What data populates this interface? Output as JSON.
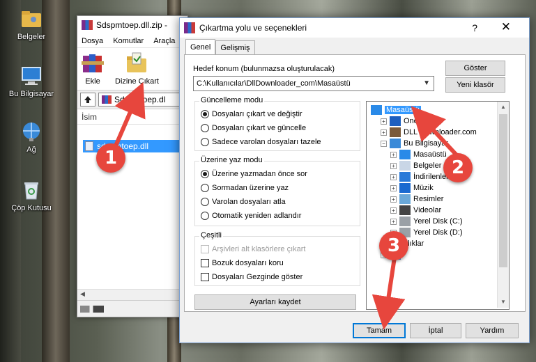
{
  "desktop": {
    "icons": [
      {
        "label": "Belgeler",
        "icon": "folder-user-icon"
      },
      {
        "label": "Bu Bilgisayar",
        "icon": "computer-icon"
      },
      {
        "label": "Ağ",
        "icon": "network-icon"
      },
      {
        "label": "Çöp Kutusu",
        "icon": "recycle-bin-icon"
      }
    ]
  },
  "bg_window": {
    "title": "Sdspmtoep.dll.zip - ",
    "menu": [
      "Dosya",
      "Komutlar",
      "Araçla"
    ],
    "toolbar": {
      "add_label": "Ekle",
      "extract_label": "Dizine Çıkart"
    },
    "address": "Sdspmtoep.dl",
    "column_header": "İsim",
    "file_name": "sdspmtoep.dll"
  },
  "dialog": {
    "title": "Çıkartma yolu ve seçenekleri",
    "help_glyph": "?",
    "close_glyph": "✕",
    "tabs": [
      "Genel",
      "Gelişmiş"
    ],
    "dest_label": "Hedef konum (bulunmazsa oluşturulacak)",
    "dest_path": "C:\\Kullanıcılar\\DllDownloader_com\\Masaüstü",
    "show_button": "Göster",
    "new_folder_button": "Yeni klasör",
    "update_mode": {
      "title": "Güncelleme modu",
      "options": [
        "Dosyaları çıkart ve değiştir",
        "Dosyaları çıkart ve güncelle",
        "Sadece varolan dosyaları tazele"
      ],
      "selected": 0
    },
    "overwrite_mode": {
      "title": "Üzerine yaz modu",
      "options": [
        "Üzerine yazmadan önce sor",
        "Sormadan üzerine yaz",
        "Varolan dosyaları atla",
        "Otomatik yeniden adlandır"
      ],
      "selected": 0
    },
    "misc": {
      "title": "Çeşitli",
      "options": [
        "Arşivleri alt klasörlere çıkart",
        "Bozuk dosyaları koru",
        "Dosyaları Gezginde göster"
      ],
      "disabled": [
        true,
        false,
        false
      ],
      "checked": [
        false,
        false,
        false
      ]
    },
    "save_settings_button": "Ayarları kaydet",
    "tree": [
      {
        "label": "Masaüstü",
        "icon": "desktop-icon",
        "level": 0,
        "selected": true,
        "expander": ""
      },
      {
        "label": "OneDrive",
        "icon": "cloud-icon",
        "level": 1,
        "expander": "+"
      },
      {
        "label": "DLL Downloader.com",
        "icon": "user-icon",
        "level": 1,
        "expander": "+"
      },
      {
        "label": "Bu Bilgisayar",
        "icon": "computer-icon",
        "level": 1,
        "expander": "−"
      },
      {
        "label": "Masaüstü",
        "icon": "desktop-icon",
        "level": 2,
        "expander": "+"
      },
      {
        "label": "Belgeler",
        "icon": "documents-icon",
        "level": 2,
        "expander": "+"
      },
      {
        "label": "İndirilenler",
        "icon": "downloads-icon",
        "level": 2,
        "expander": "+"
      },
      {
        "label": "Müzik",
        "icon": "music-icon",
        "level": 2,
        "expander": "+"
      },
      {
        "label": "Resimler",
        "icon": "pictures-icon",
        "level": 2,
        "expander": "+"
      },
      {
        "label": "Videolar",
        "icon": "videos-icon",
        "level": 2,
        "expander": "+"
      },
      {
        "label": "Yerel Disk (C:)",
        "icon": "drive-icon",
        "level": 2,
        "expander": "+"
      },
      {
        "label": "Yerel Disk (D:)",
        "icon": "drive-icon",
        "level": 2,
        "expander": "+"
      },
      {
        "label": "plıklar",
        "icon": "libraries-icon",
        "level": 1,
        "expander": "+"
      },
      {
        "label": "",
        "icon": "network-icon",
        "level": 1,
        "expander": "+"
      }
    ],
    "buttons": {
      "ok": "Tamam",
      "cancel": "İptal",
      "help": "Yardım"
    }
  },
  "annotations": {
    "markers": [
      "1",
      "2",
      "3"
    ],
    "color": "#e7463d"
  }
}
